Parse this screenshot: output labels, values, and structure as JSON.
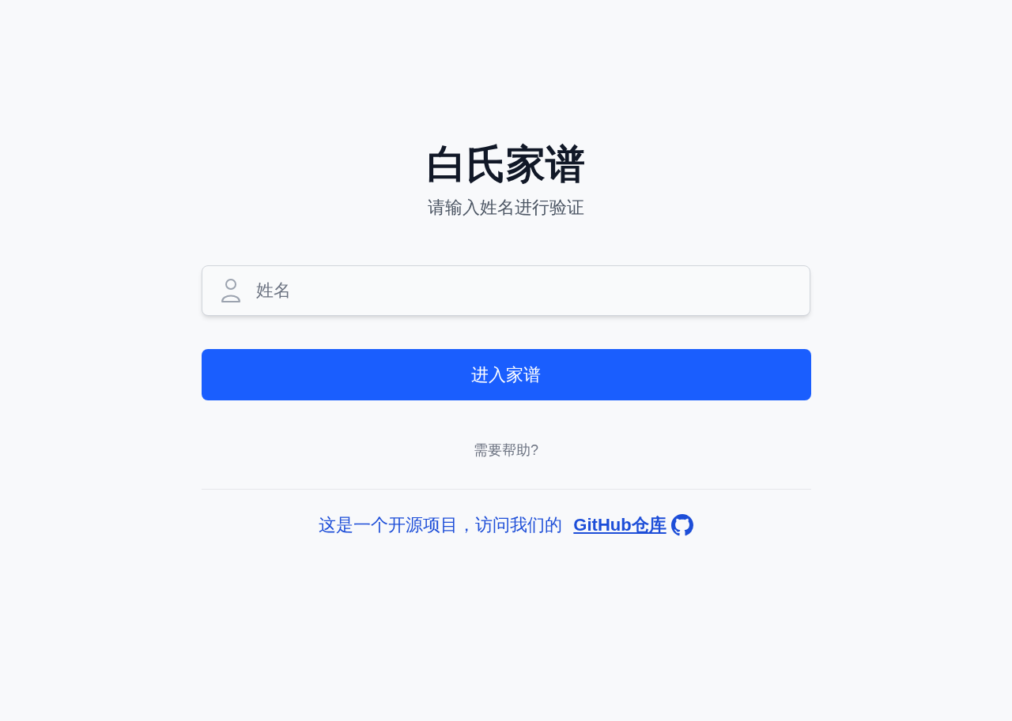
{
  "title": "白氏家谱",
  "subtitle": "请输入姓名进行验证",
  "name_field": {
    "placeholder": "姓名"
  },
  "submit_button": "进入家谱",
  "help_link": "需要帮助?",
  "footer": {
    "text": "这是一个开源项目，访问我们的",
    "link": "GitHub仓库"
  }
}
